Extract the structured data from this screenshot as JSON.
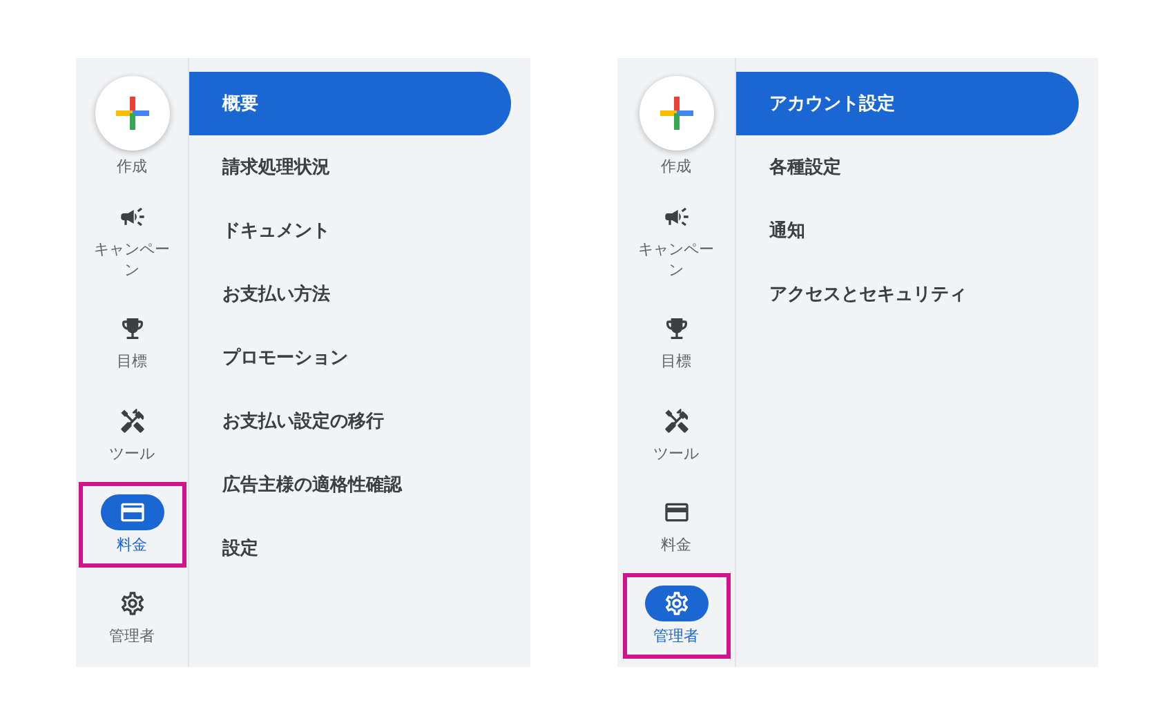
{
  "panels": [
    {
      "rail": [
        {
          "kind": "create",
          "label": "作成",
          "selected": false,
          "annotated": false
        },
        {
          "kind": "campaigns",
          "label": "キャンペーン",
          "selected": false,
          "annotated": false
        },
        {
          "kind": "goals",
          "label": "目標",
          "selected": false,
          "annotated": false
        },
        {
          "kind": "tools",
          "label": "ツール",
          "selected": false,
          "annotated": false
        },
        {
          "kind": "billing",
          "label": "料金",
          "selected": true,
          "annotated": true
        },
        {
          "kind": "admin",
          "label": "管理者",
          "selected": false,
          "annotated": false
        }
      ],
      "menu": [
        {
          "label": "概要",
          "selected": true
        },
        {
          "label": "請求処理状況",
          "selected": false
        },
        {
          "label": "ドキュメント",
          "selected": false
        },
        {
          "label": "お支払い方法",
          "selected": false
        },
        {
          "label": "プロモーション",
          "selected": false
        },
        {
          "label": "お支払い設定の移行",
          "selected": false
        },
        {
          "label": "広告主様の適格性確認",
          "selected": false
        },
        {
          "label": "設定",
          "selected": false
        }
      ]
    },
    {
      "rail": [
        {
          "kind": "create",
          "label": "作成",
          "selected": false,
          "annotated": false
        },
        {
          "kind": "campaigns",
          "label": "キャンペーン",
          "selected": false,
          "annotated": false
        },
        {
          "kind": "goals",
          "label": "目標",
          "selected": false,
          "annotated": false
        },
        {
          "kind": "tools",
          "label": "ツール",
          "selected": false,
          "annotated": false
        },
        {
          "kind": "billing",
          "label": "料金",
          "selected": false,
          "annotated": false
        },
        {
          "kind": "admin",
          "label": "管理者",
          "selected": true,
          "annotated": true
        }
      ],
      "menu": [
        {
          "label": "アカウント設定",
          "selected": true
        },
        {
          "label": "各種設定",
          "selected": false
        },
        {
          "label": "通知",
          "selected": false
        },
        {
          "label": "アクセスとセキュリティ",
          "selected": false
        }
      ]
    }
  ]
}
